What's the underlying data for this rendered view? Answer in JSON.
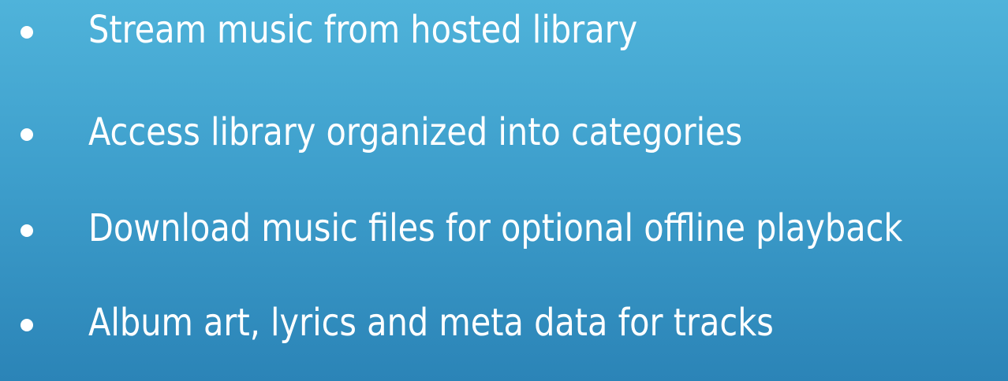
{
  "slide": {
    "bullets": [
      "Stream music from hosted library",
      "Access library organized into categories",
      "Download music files for optional offline playback",
      "Album art, lyrics and meta data for tracks"
    ]
  },
  "colors": {
    "background_top": "#4fb3da",
    "background_bottom": "#2b84b7",
    "text": "#ffffff"
  }
}
